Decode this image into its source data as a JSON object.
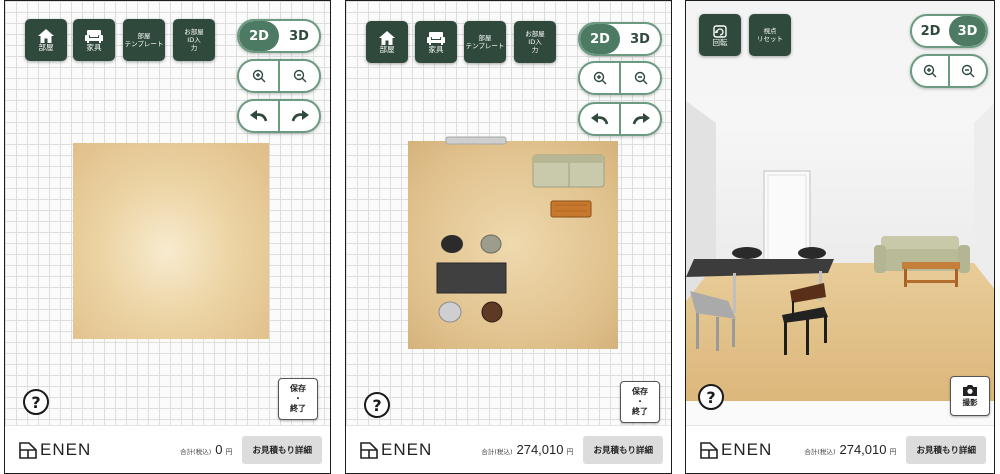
{
  "toolbar": {
    "room": "部屋",
    "furniture": "家具",
    "template": "部屋\nテンプレート",
    "room_id_input": "お部屋\nID入\n力"
  },
  "view_mode": {
    "options": [
      "2D",
      "3D"
    ]
  },
  "camera_3d": {
    "rotate": "回転",
    "reset": "視点\nリセット"
  },
  "actions": {
    "help": "?",
    "save": "保存\n・\n終了",
    "photo": "撮影"
  },
  "footer": {
    "brand": "ENEN",
    "total_label": "合計(税込)",
    "estimate_button": "お見積もり詳細",
    "currency": "円"
  },
  "screens": [
    {
      "mode": "2D",
      "total": "0"
    },
    {
      "mode": "2D",
      "total": "274,010"
    },
    {
      "mode": "3D",
      "total": "274,010"
    }
  ],
  "colors": {
    "dark_green": "#2f4a3d",
    "accent_green": "#4d7a63",
    "floor": "#e6c796"
  },
  "icons": [
    "home-icon",
    "sofa-icon",
    "zoom-in-icon",
    "zoom-out-icon",
    "undo-icon",
    "redo-icon",
    "rotate-icon",
    "camera-icon",
    "help-icon",
    "enen-logo-icon"
  ]
}
